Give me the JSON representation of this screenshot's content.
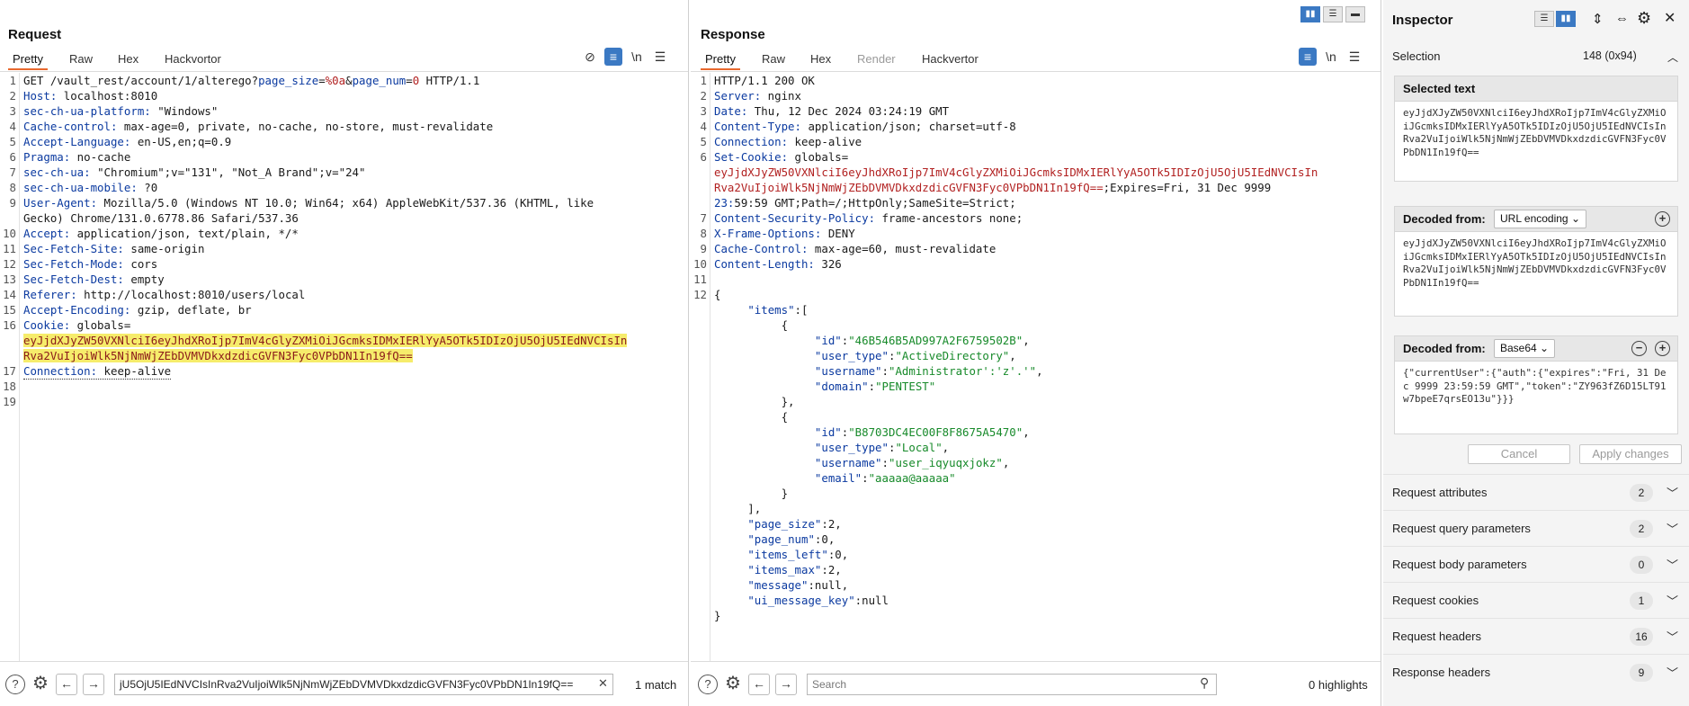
{
  "request": {
    "title": "Request",
    "tabs": [
      "Pretty",
      "Raw",
      "Hex",
      "Hackvortor"
    ],
    "lines": [
      {
        "n": "1",
        "t": "GET /vault_rest/account/1/alterego?page_size=%0a&page_num=0 HTTP/1.1"
      },
      {
        "n": "2",
        "t": "Host: localhost:8010"
      },
      {
        "n": "3",
        "t": "sec-ch-ua-platform: \"Windows\""
      },
      {
        "n": "4",
        "t": "Cache-control: max-age=0, private, no-cache, no-store, must-revalidate"
      },
      {
        "n": "5",
        "t": "Accept-Language: en-US,en;q=0.9"
      },
      {
        "n": "6",
        "t": "Pragma: no-cache"
      },
      {
        "n": "7",
        "t": "sec-ch-ua: \"Chromium\";v=\"131\", \"Not_A Brand\";v=\"24\""
      },
      {
        "n": "8",
        "t": "sec-ch-ua-mobile: ?0"
      },
      {
        "n": "9",
        "t": "User-Agent: Mozilla/5.0 (Windows NT 10.0; Win64; x64) AppleWebKit/537.36 (KHTML, like"
      },
      {
        "n": "",
        "t": "Gecko) Chrome/131.0.6778.86 Safari/537.36"
      },
      {
        "n": "10",
        "t": "Accept: application/json, text/plain, */*"
      },
      {
        "n": "11",
        "t": "Sec-Fetch-Site: same-origin"
      },
      {
        "n": "12",
        "t": "Sec-Fetch-Mode: cors"
      },
      {
        "n": "13",
        "t": "Sec-Fetch-Dest: empty"
      },
      {
        "n": "14",
        "t": "Referer: http://localhost:8010/users/local"
      },
      {
        "n": "15",
        "t": "Accept-Encoding: gzip, deflate, br"
      },
      {
        "n": "16",
        "t": "Cookie: globals="
      },
      {
        "n": "",
        "t": "eyJjdXJyZW50VXNlciI6eyJhdXRoIjp7ImV4cGlyZXMiOiJGcmksIDMxIERlYyA5OTk5IDIzOjU5OjU5IEdNVCIsIn",
        "hl": true
      },
      {
        "n": "",
        "t": "Rva2VuIjoiWlk5NjNmWjZEbDVMVDkxdzdicGVFN3Fyc0VPbDN1In19fQ==",
        "hl": true
      },
      {
        "n": "17",
        "t": "Connection: keep-alive"
      },
      {
        "n": "18",
        "t": ""
      },
      {
        "n": "19",
        "t": ""
      }
    ],
    "search_value": "jU5OjU5IEdNVCIsInRva2VuIjoiWlk5NjNmWjZEbDVMVDkxdzdicGVFN3Fyc0VPbDN1In19fQ==",
    "match_text": "1 match"
  },
  "response": {
    "title": "Response",
    "tabs": [
      "Pretty",
      "Raw",
      "Hex",
      "Render",
      "Hackvertor"
    ],
    "lines": [
      {
        "n": "1",
        "t": "HTTP/1.1 200 OK"
      },
      {
        "n": "2",
        "t": "Server: nginx"
      },
      {
        "n": "3",
        "t": "Date: Thu, 12 Dec 2024 03:24:19 GMT"
      },
      {
        "n": "4",
        "t": "Content-Type: application/json; charset=utf-8"
      },
      {
        "n": "5",
        "t": "Connection: keep-alive"
      },
      {
        "n": "6",
        "t": "Set-Cookie: globals="
      },
      {
        "n": "",
        "t": "eyJjdXJyZW50VXNlciI6eyJhdXRoIjp7ImV4cGlyZXMiOiJGcmksIDMxIERlYyA5OTk5IDIzOjU5OjU5IEdNVCIsIn",
        "cookie": true
      },
      {
        "n": "",
        "t": "Rva2VuIjoiWlk5NjNmWjZEbDVMVDkxdzdicGVFN3Fyc0VPbDN1In19fQ==;Expires=Fri, 31 Dec 9999",
        "cookie2": true
      },
      {
        "n": "",
        "t": "23:59:59 GMT;Path=/;HttpOnly;SameSite=Strict;"
      },
      {
        "n": "7",
        "t": "Content-Security-Policy: frame-ancestors none;"
      },
      {
        "n": "8",
        "t": "X-Frame-Options: DENY"
      },
      {
        "n": "9",
        "t": "Cache-Control: max-age=60, must-revalidate"
      },
      {
        "n": "10",
        "t": "Content-Length: 326"
      },
      {
        "n": "11",
        "t": ""
      },
      {
        "n": "12",
        "t": "{"
      },
      {
        "n": "",
        "t": "     \"items\":[",
        "j": true
      },
      {
        "n": "",
        "t": "          {"
      },
      {
        "n": "",
        "t": "               \"id\":\"46B546B5AD997A2F6759502B\",",
        "j": true
      },
      {
        "n": "",
        "t": "               \"user_type\":\"ActiveDirectory\",",
        "j": true
      },
      {
        "n": "",
        "t": "               \"username\":\"Administrator':'z'.'\",",
        "j": true
      },
      {
        "n": "",
        "t": "               \"domain\":\"PENTEST\"",
        "j": true
      },
      {
        "n": "",
        "t": "          },"
      },
      {
        "n": "",
        "t": "          {"
      },
      {
        "n": "",
        "t": "               \"id\":\"B8703DC4EC00F8F8675A5470\",",
        "j": true
      },
      {
        "n": "",
        "t": "               \"user_type\":\"Local\",",
        "j": true
      },
      {
        "n": "",
        "t": "               \"username\":\"user_iqyuqxjokz\",",
        "j": true
      },
      {
        "n": "",
        "t": "               \"email\":\"aaaaa@aaaaa\"",
        "j": true
      },
      {
        "n": "",
        "t": "          }"
      },
      {
        "n": "",
        "t": "     ],"
      },
      {
        "n": "",
        "t": "     \"page_size\":2,",
        "j": true
      },
      {
        "n": "",
        "t": "     \"page_num\":0,",
        "j": true
      },
      {
        "n": "",
        "t": "     \"items_left\":0,",
        "j": true
      },
      {
        "n": "",
        "t": "     \"items_max\":2,",
        "j": true
      },
      {
        "n": "",
        "t": "     \"message\":null,",
        "j": true
      },
      {
        "n": "",
        "t": "     \"ui_message_key\":null",
        "j": true
      },
      {
        "n": "",
        "t": "}"
      }
    ],
    "search_placeholder": "Search",
    "highlights_text": "0 highlights"
  },
  "inspector": {
    "title": "Inspector",
    "selection_label": "Selection",
    "selection_info": "148 (0x94)",
    "selected_text_title": "Selected text",
    "selected_text": "eyJjdXJyZW50VXNlciI6eyJhdXRoIjp7ImV4cGlyZXMiOiJGcmksIDMxIERlYyA5OTk5IDIzOjU5OjU5IEdNVCIsInRva2VuIjoiWlk5NjNmWjZEbDVMVDkxdzdicGVFN3Fyc0VPbDN1In19fQ==",
    "decoded1_title": "Decoded from:",
    "decoded1_type": "URL encoding",
    "decoded1_text": "eyJjdXJyZW50VXNlciI6eyJhdXRoIjp7ImV4cGlyZXMiOiJGcmksIDMxIERlYyA5OTk5IDIzOjU5OjU5IEdNVCIsInRva2VuIjoiWlk5NjNmWjZEbDVMVDkxdzdicGVFN3Fyc0VPbDN1In19fQ==",
    "decoded2_title": "Decoded from:",
    "decoded2_type": "Base64",
    "decoded2_text": "{\"currentUser\":{\"auth\":{\"expires\":\"Fri, 31 Dec 9999 23:59:59 GMT\",\"token\":\"ZY963fZ6D15LT91w7bpeE7qrsEO13u\"}}}",
    "cancel_label": "Cancel",
    "apply_label": "Apply changes",
    "sections": [
      {
        "label": "Request attributes",
        "count": "2"
      },
      {
        "label": "Request query parameters",
        "count": "2"
      },
      {
        "label": "Request body parameters",
        "count": "0"
      },
      {
        "label": "Request cookies",
        "count": "1"
      },
      {
        "label": "Request headers",
        "count": "16"
      },
      {
        "label": "Response headers",
        "count": "9"
      }
    ]
  },
  "colors": {
    "accent": "#e8692f",
    "toggle": "#3b79c3",
    "highlight": "#f6ec6b"
  }
}
